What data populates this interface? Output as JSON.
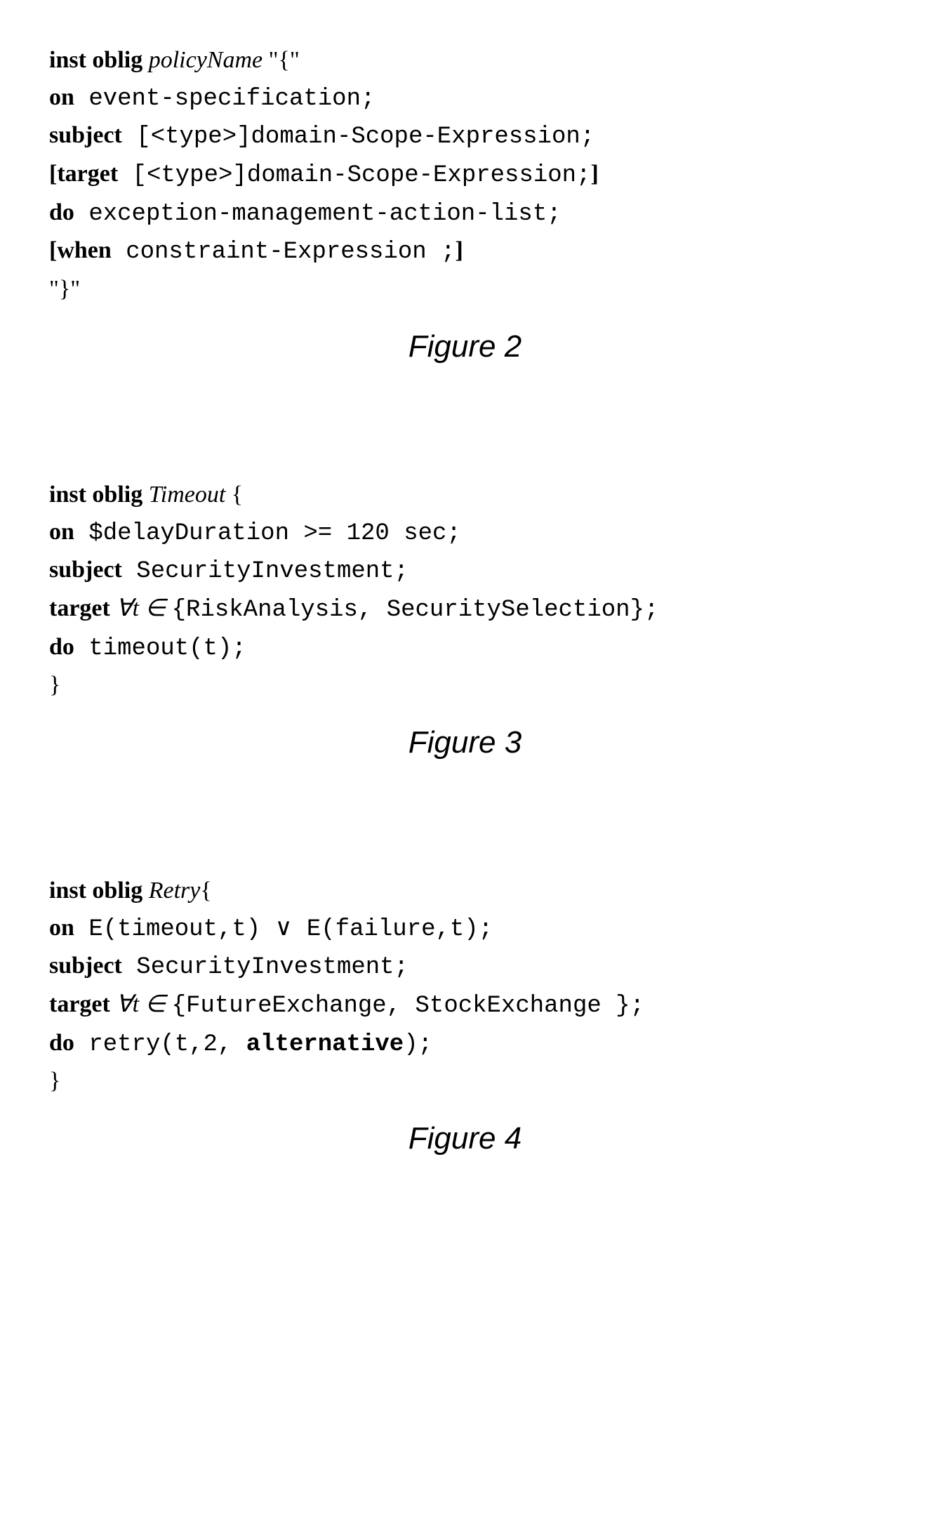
{
  "fig2": {
    "l1_kw": "inst oblig",
    "l1_ital": " policyName ",
    "l1_rest": "\"{\"",
    "l2_kw": "on",
    "l2_mono": " event-specification;",
    "l3_kw": "subject",
    "l3_mono": " [<type>]domain-Scope-Expression;",
    "l4_kw": "[target",
    "l4_mono": " [<type>]domain-Scope-Expression;",
    "l4_end": "]",
    "l5_kw": "do",
    "l5_mono": " exception-management-action-list;",
    "l6_kw": "[when",
    "l6_mono": " constraint-Expression ;",
    "l6_end": "]",
    "l7": "\"}\"",
    "caption": "Figure 2"
  },
  "fig3": {
    "l1_kw": "inst oblig",
    "l1_ital": " Timeout ",
    "l1_rest": "{",
    "l2_kw": "on",
    "l2_mono": " $delayDuration >= 120 sec;",
    "l3_kw": "subject",
    "l3_mono": " SecurityInvestment;",
    "l4_kw": "target",
    "l4_math": " ∀t ∈ ",
    "l4_mono": "{RiskAnalysis, SecuritySelection};",
    "l5_kw": "do",
    "l5_mono": " timeout(t);",
    "l6": "}",
    "caption": "Figure 3"
  },
  "fig4": {
    "l1_kw": "inst oblig",
    "l1_ital": " Retry",
    "l1_rest": "{",
    "l2_kw": "on",
    "l2_mono": " E(timeout,t) ",
    "l2_or": "∨",
    "l2_mono2": " E(failure,t);",
    "l3_kw": "subject",
    "l3_mono": " SecurityInvestment;",
    "l4_kw": "target",
    "l4_math": " ∀t ∈ ",
    "l4_mono": "{FutureExchange, StockExchange };",
    "l5_kw": "do",
    "l5_mono": " retry(t,2, ",
    "l5_bold": "alternative",
    "l5_mono2": ");",
    "l6": "}",
    "caption": "Figure 4"
  }
}
